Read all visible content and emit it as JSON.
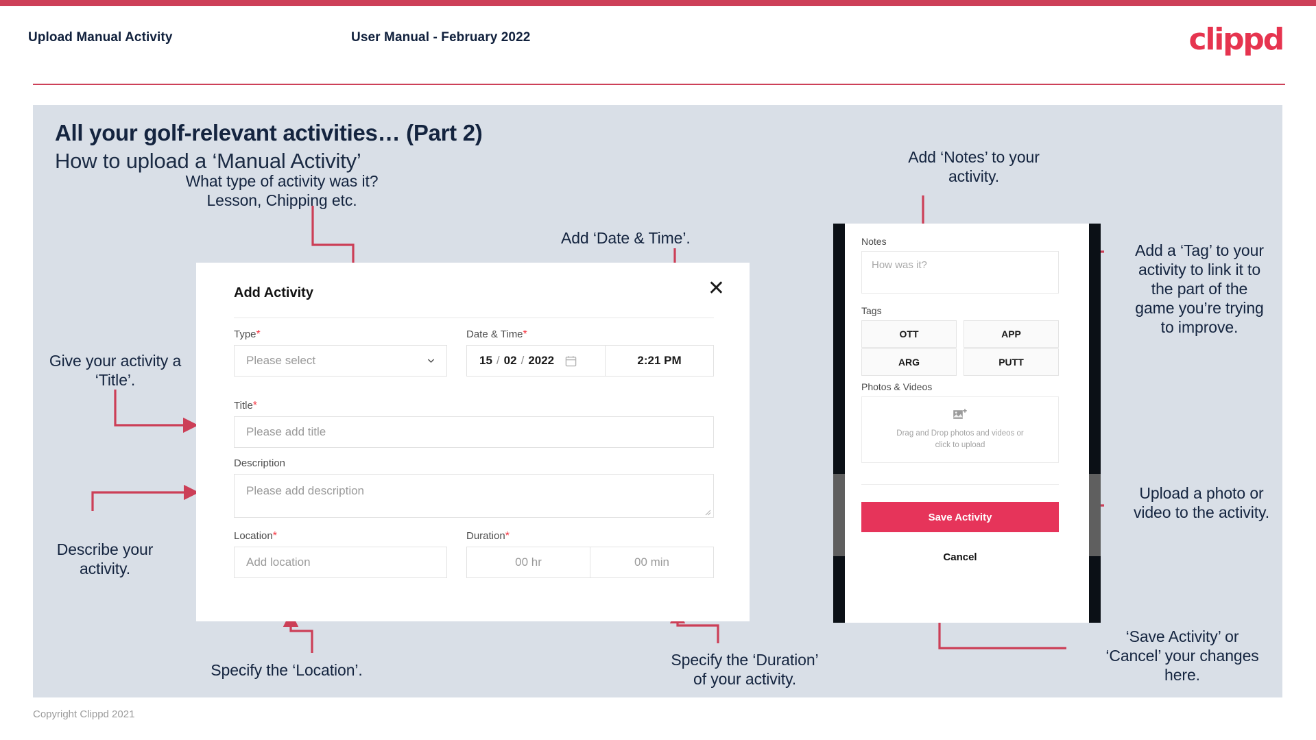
{
  "theme": {
    "accent": "#cd4058",
    "logo_color": "#e6344f",
    "slide_bg": "#d9dfe7",
    "heading_color": "#14243f",
    "save_button_color": "#e6345a",
    "required_marker_color": "#f5333f"
  },
  "header": {
    "left_title": "Upload Manual Activity",
    "center_title": "User Manual - February 2022",
    "logo": "clippd"
  },
  "slide": {
    "title_line1": "All your golf-relevant activities… (Part 2)",
    "title_line2": "How to upload a ‘Manual Activity’"
  },
  "annotations": [
    {
      "id": "type",
      "text": "What type of activity was it?\nLesson, Chipping etc."
    },
    {
      "id": "datetime",
      "text": "Add ‘Date & Time’."
    },
    {
      "id": "notes",
      "text": "Add ‘Notes’ to your\nactivity."
    },
    {
      "id": "tag",
      "text": "Add a ‘Tag’ to your\nactivity to link it to\nthe part of the\ngame you’re trying\nto improve."
    },
    {
      "id": "title",
      "text": "Give your activity a\n‘Title’."
    },
    {
      "id": "description",
      "text": "Describe your\nactivity."
    },
    {
      "id": "location",
      "text": "Specify the ‘Location’."
    },
    {
      "id": "duration",
      "text": "Specify the ‘Duration’\nof your activity."
    },
    {
      "id": "upload",
      "text": "Upload a photo or\nvideo to the activity."
    },
    {
      "id": "save",
      "text": "‘Save Activity’ or\n‘Cancel’ your changes\nhere."
    }
  ],
  "dialog": {
    "title": "Add Activity",
    "close_label": "✕",
    "fields": {
      "type": {
        "label": "Type",
        "required": "*",
        "placeholder": "Please select",
        "value": ""
      },
      "datetime": {
        "label": "Date & Time",
        "required": "*",
        "day": "15",
        "month": "02",
        "year": "2022",
        "sep": "/",
        "time": "2:21 PM"
      },
      "title": {
        "label": "Title",
        "required": "*",
        "placeholder": "Please add title",
        "value": ""
      },
      "description": {
        "label": "Description",
        "required": "",
        "placeholder": "Please add description",
        "value": ""
      },
      "location": {
        "label": "Location",
        "required": "*",
        "placeholder": "Add location",
        "value": ""
      },
      "duration": {
        "label": "Duration",
        "required": "*",
        "hours_placeholder": "00 hr",
        "minutes_placeholder": "00 min"
      }
    }
  },
  "phone": {
    "notes": {
      "label": "Notes",
      "placeholder": "How was it?",
      "value": ""
    },
    "tags": {
      "label": "Tags",
      "items": [
        "OTT",
        "APP",
        "ARG",
        "PUTT"
      ]
    },
    "photos": {
      "label": "Photos & Videos",
      "drop_line1": "Drag and Drop photos and videos or",
      "drop_line2": "click to upload"
    },
    "save_label": "Save Activity",
    "cancel_label": "Cancel"
  },
  "footer": {
    "copyright": "Copyright Clippd 2021"
  }
}
